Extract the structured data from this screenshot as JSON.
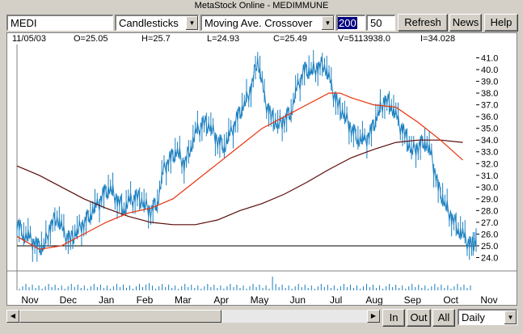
{
  "window": {
    "title": "MetaStock Online - MEDIMMUNE"
  },
  "toolbar": {
    "symbol": "MEDI",
    "chart_style": "Candlesticks",
    "indicator": "Moving Ave. Crossover",
    "period1": "200",
    "period2": "50",
    "refresh_label": "Refresh",
    "news_label": "News",
    "help_label": "Help"
  },
  "quote": {
    "date": "11/05/03",
    "open": "O=25.05",
    "high": "H=25.7",
    "low": "L=24.93",
    "close": "C=25.49",
    "volume": "V=5113938.0",
    "interest": "I=34.028"
  },
  "bottom": {
    "in_label": "In",
    "out_label": "Out",
    "all_label": "All",
    "interval": "Daily"
  },
  "icons": {
    "dropdown": "chevron-down-icon",
    "scroll_left": "arrow-left-icon",
    "scroll_right": "arrow-right-icon"
  },
  "colors": {
    "price": "#1a7fc0",
    "ma_fast": "#e8320c",
    "ma_slow": "#5a0a0a",
    "selection": "#000080"
  },
  "chart_data": {
    "type": "line",
    "y_ticks": [
      "24.0",
      "25.0",
      "26.0",
      "27.0",
      "28.0",
      "29.0",
      "30.0",
      "31.0",
      "32.0",
      "33.0",
      "34.0",
      "35.0",
      "36.0",
      "37.0",
      "38.0",
      "39.0",
      "40.0",
      "41.0"
    ],
    "ylim": [
      23.0,
      42.0
    ],
    "x_labels": [
      "Nov",
      "Dec",
      "Jan",
      "Feb",
      "Mar",
      "Apr",
      "May",
      "Jun",
      "Jul",
      "Aug",
      "Sep",
      "Oct",
      "Nov"
    ],
    "reference_line": 25.0,
    "price_points": [
      [
        0.0,
        27.0
      ],
      [
        0.3,
        26.0
      ],
      [
        0.6,
        25.5
      ],
      [
        0.9,
        25.0
      ],
      [
        1.2,
        24.8
      ],
      [
        1.5,
        26.8
      ],
      [
        1.8,
        27.5
      ],
      [
        2.1,
        26.0
      ],
      [
        2.4,
        25.5
      ],
      [
        2.7,
        26.2
      ],
      [
        3.0,
        27.0
      ],
      [
        3.3,
        27.8
      ],
      [
        3.6,
        28.3
      ],
      [
        3.9,
        29.5
      ],
      [
        4.2,
        29.8
      ],
      [
        4.5,
        29.0
      ],
      [
        4.8,
        28.2
      ],
      [
        5.1,
        28.8
      ],
      [
        5.4,
        29.2
      ],
      [
        5.7,
        28.5
      ],
      [
        6.0,
        28.0
      ],
      [
        6.3,
        28.8
      ],
      [
        6.6,
        31.5
      ],
      [
        6.9,
        32.5
      ],
      [
        7.2,
        33.0
      ],
      [
        7.5,
        32.0
      ],
      [
        7.8,
        33.5
      ],
      [
        8.1,
        34.8
      ],
      [
        8.4,
        35.5
      ],
      [
        8.7,
        35.0
      ],
      [
        9.0,
        34.0
      ],
      [
        9.3,
        33.5
      ],
      [
        9.6,
        34.5
      ],
      [
        9.9,
        36.0
      ],
      [
        10.2,
        37.0
      ],
      [
        10.5,
        38.5
      ],
      [
        10.8,
        41.0
      ],
      [
        11.1,
        37.5
      ],
      [
        11.4,
        36.0
      ],
      [
        11.7,
        35.2
      ],
      [
        12.0,
        35.8
      ],
      [
        12.3,
        36.5
      ],
      [
        12.6,
        38.5
      ],
      [
        12.9,
        40.0
      ],
      [
        13.2,
        39.8
      ],
      [
        13.5,
        40.3
      ],
      [
        13.8,
        40.5
      ],
      [
        14.1,
        38.5
      ],
      [
        14.4,
        37.0
      ],
      [
        14.7,
        36.0
      ],
      [
        15.0,
        35.0
      ],
      [
        15.3,
        34.2
      ],
      [
        15.6,
        33.8
      ],
      [
        15.9,
        34.8
      ],
      [
        16.2,
        36.2
      ],
      [
        16.5,
        37.5
      ],
      [
        16.8,
        37.0
      ],
      [
        17.1,
        35.5
      ],
      [
        17.4,
        34.5
      ],
      [
        17.7,
        33.0
      ],
      [
        18.0,
        33.5
      ],
      [
        18.3,
        34.0
      ],
      [
        18.6,
        32.5
      ],
      [
        18.9,
        30.0
      ],
      [
        19.2,
        28.5
      ],
      [
        19.5,
        27.5
      ],
      [
        19.8,
        26.5
      ],
      [
        20.1,
        25.5
      ],
      [
        20.4,
        25.0
      ],
      [
        20.6,
        25.49
      ]
    ],
    "ma_fast_points": [
      [
        0.0,
        25.8
      ],
      [
        1.0,
        24.7
      ],
      [
        2.0,
        25.0
      ],
      [
        3.0,
        26.0
      ],
      [
        4.0,
        27.0
      ],
      [
        5.0,
        27.8
      ],
      [
        6.0,
        28.2
      ],
      [
        7.0,
        29.0
      ],
      [
        8.0,
        30.5
      ],
      [
        9.0,
        32.0
      ],
      [
        10.0,
        33.5
      ],
      [
        11.0,
        35.0
      ],
      [
        12.0,
        36.0
      ],
      [
        13.0,
        37.0
      ],
      [
        14.0,
        38.0
      ],
      [
        14.5,
        38.0
      ],
      [
        15.0,
        37.6
      ],
      [
        16.0,
        37.0
      ],
      [
        17.0,
        36.8
      ],
      [
        18.0,
        35.5
      ],
      [
        19.0,
        34.0
      ],
      [
        20.0,
        32.3
      ]
    ],
    "ma_slow_points": [
      [
        0.0,
        31.8
      ],
      [
        1.0,
        31.0
      ],
      [
        2.0,
        30.0
      ],
      [
        3.0,
        29.0
      ],
      [
        4.0,
        28.2
      ],
      [
        5.0,
        27.5
      ],
      [
        6.0,
        27.0
      ],
      [
        7.0,
        26.8
      ],
      [
        8.0,
        26.8
      ],
      [
        9.0,
        27.2
      ],
      [
        10.0,
        28.0
      ],
      [
        11.0,
        28.6
      ],
      [
        12.0,
        29.4
      ],
      [
        13.0,
        30.4
      ],
      [
        14.0,
        31.5
      ],
      [
        15.0,
        32.5
      ],
      [
        16.0,
        33.2
      ],
      [
        17.0,
        33.8
      ],
      [
        18.0,
        34.0
      ],
      [
        19.0,
        34.0
      ],
      [
        20.0,
        33.8
      ]
    ]
  }
}
